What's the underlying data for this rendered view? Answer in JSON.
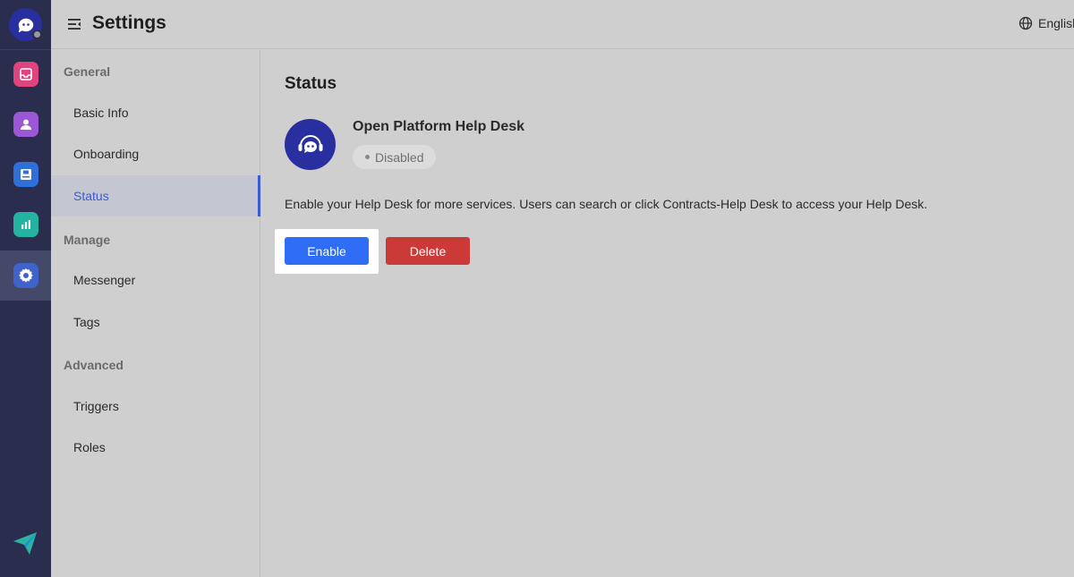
{
  "header": {
    "title": "Settings",
    "language": "English"
  },
  "rail": {
    "items": [
      {
        "icon": "inbox-icon",
        "color": "#e0447f"
      },
      {
        "icon": "contacts-icon",
        "color": "#9b57d6"
      },
      {
        "icon": "knowledge-base-icon",
        "color": "#2f6fd8"
      },
      {
        "icon": "reports-icon",
        "color": "#23b3a0"
      },
      {
        "icon": "settings-icon",
        "color": "#3f63c8"
      }
    ]
  },
  "nav": {
    "groups": {
      "general": "General",
      "manage": "Manage",
      "advanced": "Advanced"
    },
    "items": {
      "basic_info": "Basic Info",
      "onboarding": "Onboarding",
      "status": "Status",
      "messenger": "Messenger",
      "tags": "Tags",
      "triggers": "Triggers",
      "roles": "Roles"
    }
  },
  "main": {
    "section_title": "Status",
    "desk_name": "Open Platform Help Desk",
    "status": "Disabled",
    "description": "Enable your Help Desk for more services. Users can search or click Contracts-Help Desk to access your Help Desk.",
    "enable_label": "Enable",
    "delete_label": "Delete"
  },
  "colors": {
    "accent": "#2f6df6",
    "danger": "#cc3a38",
    "rail_bg": "#2a2d4e",
    "brand": "#2a2fa0"
  }
}
